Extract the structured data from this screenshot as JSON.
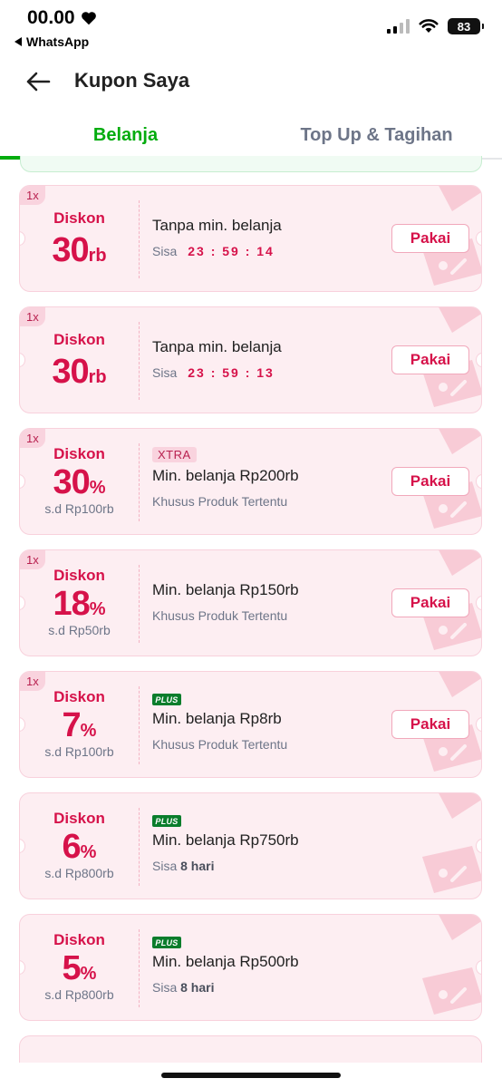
{
  "status_bar": {
    "time": "00.00",
    "back_app": "WhatsApp",
    "battery": "83"
  },
  "header": {
    "title": "Kupon Saya"
  },
  "tabs": [
    {
      "label": "Belanja",
      "active": true
    },
    {
      "label": "Top Up & Tagihan",
      "active": false
    }
  ],
  "coupons": [
    {
      "qty": "1x",
      "label": "Diskon",
      "value": "30",
      "unit": "rb",
      "cap": "",
      "tag": "",
      "title": "Tanpa min. belanja",
      "sub_prefix": "Sisa",
      "sub_bold": "",
      "timer": "23 : 59 : 14",
      "button": "Pakai"
    },
    {
      "qty": "1x",
      "label": "Diskon",
      "value": "30",
      "unit": "rb",
      "cap": "",
      "tag": "",
      "title": "Tanpa min. belanja",
      "sub_prefix": "Sisa",
      "sub_bold": "",
      "timer": "23 : 59 : 13",
      "button": "Pakai"
    },
    {
      "qty": "1x",
      "label": "Diskon",
      "value": "30",
      "unit": "%",
      "cap": "s.d Rp100rb",
      "tag": "XTRA",
      "title": "Min. belanja Rp200rb",
      "sub_prefix": "Khusus Produk Tertentu",
      "sub_bold": "",
      "timer": "",
      "button": "Pakai"
    },
    {
      "qty": "1x",
      "label": "Diskon",
      "value": "18",
      "unit": "%",
      "cap": "s.d Rp50rb",
      "tag": "",
      "title": "Min. belanja Rp150rb",
      "sub_prefix": "Khusus Produk Tertentu",
      "sub_bold": "",
      "timer": "",
      "button": "Pakai"
    },
    {
      "qty": "1x",
      "label": "Diskon",
      "value": "7",
      "unit": "%",
      "cap": "s.d Rp100rb",
      "tag": "PLUS",
      "title": "Min. belanja Rp8rb",
      "sub_prefix": "Khusus Produk Tertentu",
      "sub_bold": "",
      "timer": "",
      "button": "Pakai"
    },
    {
      "qty": "",
      "label": "Diskon",
      "value": "6",
      "unit": "%",
      "cap": "s.d Rp800rb",
      "tag": "PLUS",
      "title": "Min. belanja Rp750rb",
      "sub_prefix": "Sisa",
      "sub_bold": "8 hari",
      "timer": "",
      "button": ""
    },
    {
      "qty": "",
      "label": "Diskon",
      "value": "5",
      "unit": "%",
      "cap": "s.d Rp800rb",
      "tag": "PLUS",
      "title": "Min. belanja Rp500rb",
      "sub_prefix": "Sisa",
      "sub_bold": "8 hari",
      "timer": "",
      "button": ""
    }
  ],
  "colors": {
    "brand_green": "#03AC0E",
    "coupon_red": "#D6124A",
    "coupon_bg": "#FDEEF2"
  }
}
